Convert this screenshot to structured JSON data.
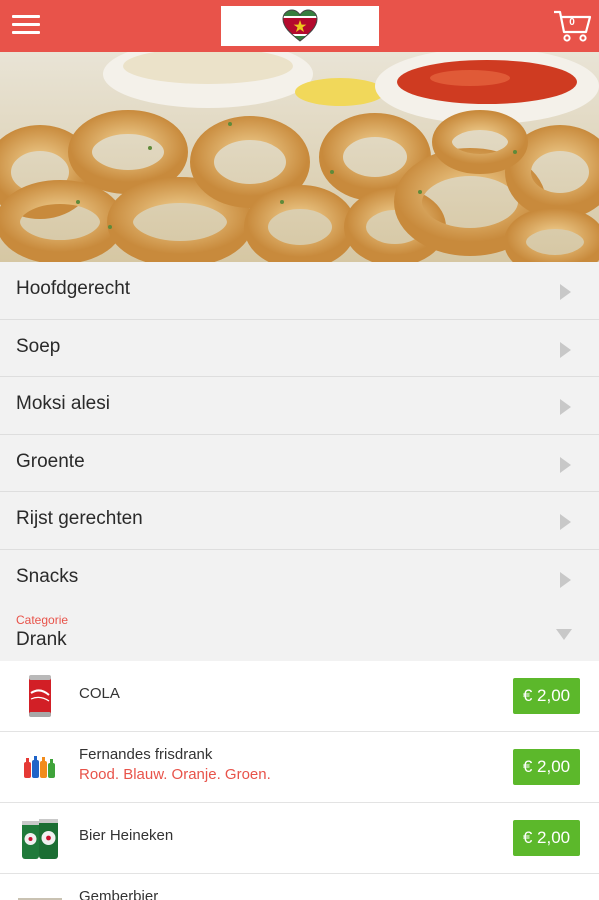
{
  "header": {
    "menu_icon": "hamburger-menu-icon",
    "logo_icon": "suriname-flag-heart-icon",
    "cart_icon": "shopping-cart-icon",
    "cart_count": "0",
    "colors": {
      "bar": "#e8534a",
      "logo_bg": "#ffffff"
    }
  },
  "hero": {
    "image": "fried-calamari-rings-with-dips"
  },
  "categories": [
    {
      "label": "Hoofdgerecht"
    },
    {
      "label": "Soep"
    },
    {
      "label": "Moksi alesi"
    },
    {
      "label": "Groente"
    },
    {
      "label": "Rijst gerechten"
    },
    {
      "label": "Snacks"
    }
  ],
  "category_select": {
    "caption": "Categorie",
    "value": "Drank"
  },
  "products": [
    {
      "name": "COLA",
      "subtitle": "",
      "price": "€ 2,00",
      "icon": "cola-can-icon"
    },
    {
      "name": "Fernandes frisdrank",
      "subtitle": "Rood. Blauw. Oranje. Groen.",
      "price": "€ 2,00",
      "icon": "soda-bottles-icon"
    },
    {
      "name": "Bier Heineken",
      "subtitle": "",
      "price": "€ 2,00",
      "icon": "beer-cans-icon"
    },
    {
      "name": "Gemberbier",
      "subtitle": "",
      "price": "",
      "icon": "ginger-beer-icon"
    }
  ],
  "colors": {
    "accent": "#e8534a",
    "price_green": "#5cb82b",
    "row_bg": "#f2f2f2"
  }
}
